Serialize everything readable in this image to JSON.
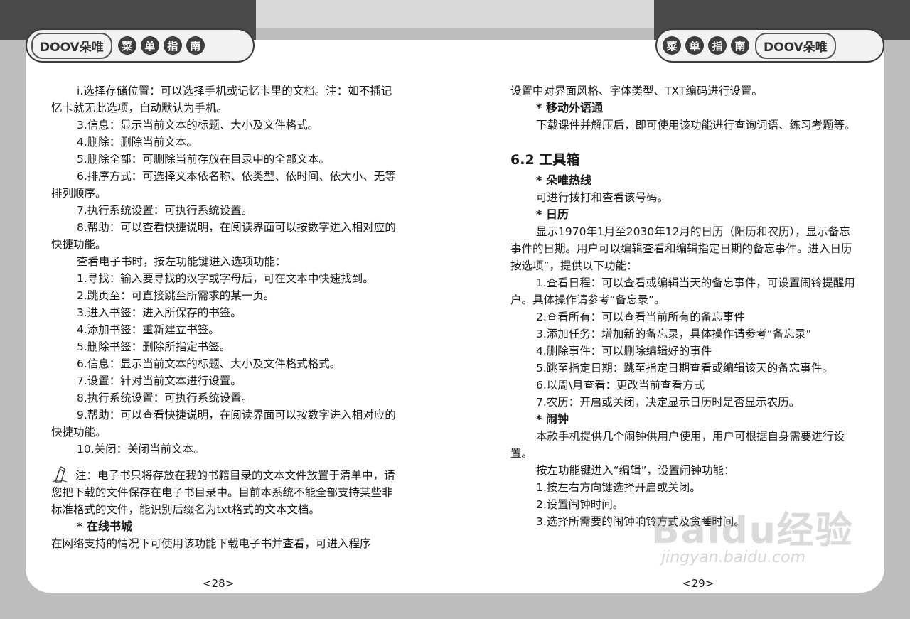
{
  "header": {
    "logo": "DOOV朵唯",
    "menu_chars": [
      "菜",
      "单",
      "指",
      "南"
    ]
  },
  "left_page": {
    "lines": [
      "i.选择存储位置：可以选择手机或记忆卡里的文档。注：如不插记忆卡就无此选项，自动默认为手机。",
      "3.信息：显示当前文本的标题、大小及文件格式。",
      "4.删除：删除当前文本。",
      "5.删除全部：可删除当前存放在目录中的全部文本。",
      "6.排序方式：可选择文本依名称、依类型、依时间、依大小、无等排列顺序。",
      "7.执行系统设置：可执行系统设置。",
      "8.帮助：可以查看快捷说明，在阅读界面可以按数字进入相对应的快捷功能。",
      "查看电子书时，按左功能键进入选项功能：",
      "1.寻找：输入要寻找的汉字或字母后，可在文本中快速找到。",
      "2.跳页至：可直接跳至所需求的某一页。",
      "3.进入书签：进入所保存的书签。",
      "4.添加书签：重新建立书签。",
      "5.删除书签：删除所指定书签。",
      "6.信息：显示当前文本的标题、大小及文件格式格式。",
      "7.设置：针对当前文本进行设置。",
      "8.执行系统设置：可执行系统设置。",
      "9.帮助：可以查看快捷说明，在阅读界面可以按数字进入相对应的快捷功能。",
      "10.关闭：关闭当前文本。"
    ],
    "note": "注：电子书只将存放在我的书籍目录的文本文件放置于清单中，请您把下载的文件保存在电子书目录中。目前本系统不能全部支持某些非标准格式的文件，能识别后缀名为txt格式的文本文档。",
    "heading_online": "* 在线书城",
    "online_text": "在网络支持的情况下可使用该功能下载电子书并查看，可进入程序",
    "page_number": "<28>"
  },
  "right_page": {
    "intro": "设置中对界面风格、字体类型、TXT编码进行设置。",
    "heading_mobile": "* 移动外语通",
    "mobile_text": "下载课件并解压后，即可使用该功能进行查询词语、练习考题等。",
    "section_title": "6.2 工具箱",
    "heading_hotline": "* 朵唯热线",
    "hotline_text": "可进行拨打和查看该号码。",
    "heading_calendar": "* 日历",
    "calendar_text": "显示1970年1月至2030年12月的日历（阳历和农历），显示备忘事件的日期。用户可以编辑查看和编辑指定日期的备忘事件。进入日历按选项”，提供以下功能：",
    "calendar_items": [
      "1.查看日程：可以查看或编辑当天的备忘事件，可设置闹铃提醒用户。具体操作请参考“备忘录”。",
      "2.查看所有：可以查看当前所有的备忘事件",
      "3.添加任务：增加新的备忘录，具体操作请参考“备忘录”",
      "4.删除事件：可以删除编辑好的事件",
      "5.跳至指定日期：跳至指定日期查看或编辑该天的备忘事件。",
      "6.以周\\月查看：更改当前查看方式",
      "7.农历：开启或关闭，决定显示日历时是否显示农历。"
    ],
    "heading_alarm": "* 闹钟",
    "alarm_text": "本款手机提供几个闹钟供用户使用，用户可根据自身需要进行设置。",
    "alarm_intro": "按左功能键进入“编辑”，设置闹钟功能：",
    "alarm_items": [
      "1.按左右方向键选择开启或关闭。",
      "2.设置闹钟时间。",
      "3.选择所需要的闹钟响铃方式及贪睡时间。"
    ],
    "page_number": "<29>"
  },
  "watermark": {
    "brand": "Baidu经验",
    "url": "jingyan.baidu.com"
  }
}
